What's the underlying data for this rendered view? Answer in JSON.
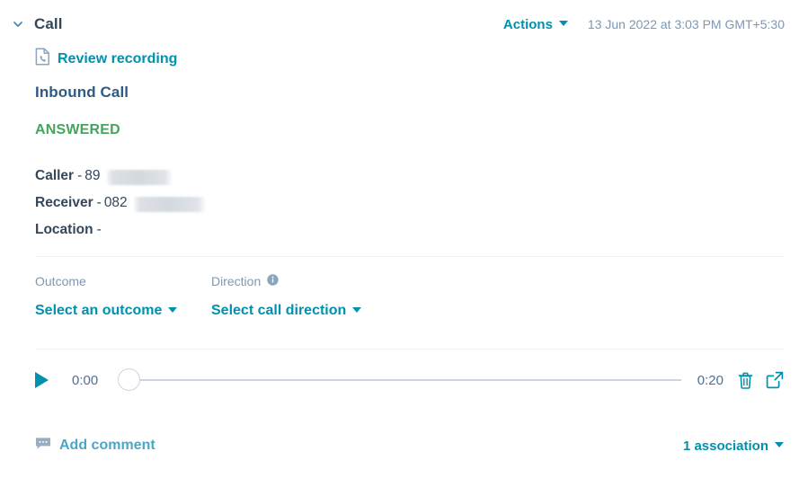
{
  "header": {
    "toggle_icon": "chevron-down-icon",
    "title": "Call",
    "actions_label": "Actions",
    "actions_caret_icon": "caret-down-icon",
    "timestamp": "13 Jun 2022 at 3:03 PM GMT+5:30"
  },
  "review": {
    "icon": "call-document-icon",
    "label": "Review recording"
  },
  "call": {
    "type": "Inbound Call",
    "status": "ANSWERED",
    "status_color": "#45a45e",
    "details": [
      {
        "label": "Caller",
        "separator": "-",
        "value": "89",
        "redacted": true
      },
      {
        "label": "Receiver",
        "separator": "-",
        "value": "082",
        "redacted": true
      },
      {
        "label": "Location",
        "separator": "-",
        "value": "",
        "redacted": false
      }
    ]
  },
  "fields": {
    "outcome": {
      "label": "Outcome",
      "selected": "Select an outcome",
      "caret_icon": "caret-down-icon"
    },
    "direction": {
      "label": "Direction",
      "info_icon": "info-circle-icon",
      "selected": "Select call direction",
      "caret_icon": "caret-down-icon"
    }
  },
  "player": {
    "play_icon": "play-icon",
    "current_time": "0:00",
    "total_time": "0:20",
    "progress_percent": 0,
    "delete_icon": "trash-icon",
    "popout_icon": "external-link-icon"
  },
  "footer": {
    "comment_icon": "comment-bubble-icon",
    "add_comment_label": "Add comment",
    "association_label": "1 association",
    "association_caret_icon": "caret-down-icon"
  },
  "theme": {
    "link": "#0091ae",
    "text": "#33475b",
    "muted": "#7c98b6",
    "divider": "#eaf0f6"
  }
}
